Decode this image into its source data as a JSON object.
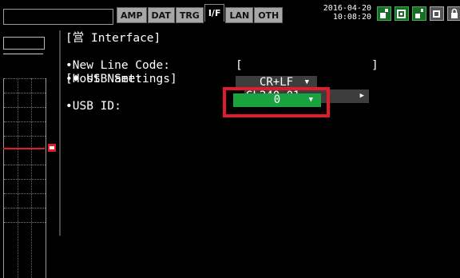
{
  "tabs": [
    {
      "label": "AMP",
      "active": false
    },
    {
      "label": "DAT",
      "active": false
    },
    {
      "label": "TRG",
      "active": false
    },
    {
      "label": "I/F",
      "active": true
    },
    {
      "label": "LAN",
      "active": false
    },
    {
      "label": "OTH",
      "active": false
    }
  ],
  "datetime": {
    "date": "2016-04-20",
    "time": "10:08:20"
  },
  "status_icons": [
    "memory-card-icon",
    "usb-memory-icon",
    "sd-card-icon",
    "battery-icon",
    "lock-icon"
  ],
  "interface": {
    "header": "[営 Interface]",
    "new_line_code_label": "•New Line Code:",
    "new_line_code_value": "CR+LF",
    "host_name_label": "•Host Name:",
    "host_name_value": "GL240_01"
  },
  "usb": {
    "header": "[♦ USB Settings]",
    "usb_id_label": "•USB ID:",
    "usb_id_value": "0"
  },
  "colors": {
    "accent_green": "#19a23d",
    "highlight_red": "#e01b2a"
  }
}
